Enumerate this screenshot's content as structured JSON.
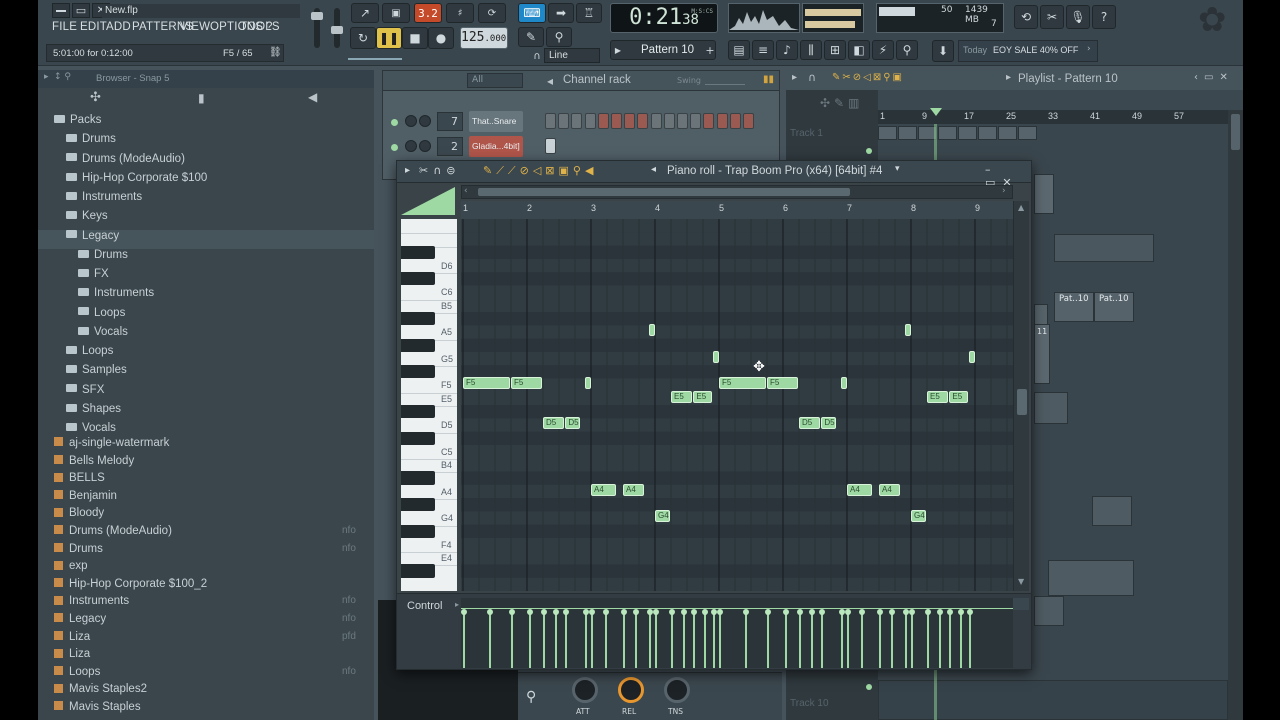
{
  "topbar": {
    "title": "New.flp",
    "menu": [
      "FILE",
      "EDIT",
      "ADD",
      "PATTERNS",
      "VIEW",
      "OPTIONS",
      "TOOLS",
      "?"
    ],
    "hint_left": "5:01:00 for 0:12:00",
    "hint_right": "F5 / 65",
    "snap_value": "3.2",
    "tempo": "125",
    "tempo_decimal": ".000",
    "time": "0:21",
    "time_small": "38",
    "time_format": "M:S:CS",
    "pattern": "Pattern 10",
    "line": "Line",
    "cpu": "50",
    "memory": "1439 MB",
    "voices": "7",
    "news_day": "Today",
    "news_text": "EOY SALE 40% OFF"
  },
  "browser": {
    "title": "Browser - Snap 5",
    "tree": [
      {
        "label": "Packs",
        "indent": 0
      },
      {
        "label": "Drums",
        "indent": 1
      },
      {
        "label": "Drums (ModeAudio)",
        "indent": 1
      },
      {
        "label": "Hip-Hop Corporate $100",
        "indent": 1
      },
      {
        "label": "Instruments",
        "indent": 1
      },
      {
        "label": "Keys",
        "indent": 1
      },
      {
        "label": "Legacy",
        "indent": 1
      },
      {
        "label": "Drums",
        "indent": 2
      },
      {
        "label": "FX",
        "indent": 2
      },
      {
        "label": "Instruments",
        "indent": 2
      },
      {
        "label": "Loops",
        "indent": 2
      },
      {
        "label": "Vocals",
        "indent": 2
      },
      {
        "label": "Loops",
        "indent": 1
      },
      {
        "label": "Samples",
        "indent": 1
      },
      {
        "label": "SFX",
        "indent": 1
      },
      {
        "label": "Shapes",
        "indent": 1
      },
      {
        "label": "Vocals",
        "indent": 1
      }
    ],
    "files": [
      {
        "label": "aj-single-watermark",
        "ext": ""
      },
      {
        "label": "Bells Melody",
        "ext": ""
      },
      {
        "label": "BELLS",
        "ext": ""
      },
      {
        "label": "Benjamin",
        "ext": ""
      },
      {
        "label": "Bloody",
        "ext": ""
      },
      {
        "label": "Drums (ModeAudio)",
        "ext": "nfo"
      },
      {
        "label": "Drums",
        "ext": "nfo"
      },
      {
        "label": "exp",
        "ext": ""
      },
      {
        "label": "Hip-Hop Corporate $100_2",
        "ext": ""
      },
      {
        "label": "Instruments",
        "ext": "nfo"
      },
      {
        "label": "Legacy",
        "ext": "nfo"
      },
      {
        "label": "Liza",
        "ext": "pfd"
      },
      {
        "label": "Liza",
        "ext": ""
      },
      {
        "label": "Loops",
        "ext": "nfo"
      },
      {
        "label": "Mavis Staples2",
        "ext": ""
      },
      {
        "label": "Mavis Staples",
        "ext": ""
      }
    ]
  },
  "channel_rack": {
    "filter": "All",
    "title": "Channel rack",
    "swing": "Swing",
    "channels": [
      {
        "num": "7",
        "name": "That..Snare"
      },
      {
        "num": "2",
        "name": "Gladia...4bit]"
      }
    ]
  },
  "playlist": {
    "title": "Playlist - Pattern 10",
    "bar_numbers": [
      "1",
      "9",
      "17",
      "25",
      "33",
      "41",
      "49",
      "57"
    ],
    "track_first": "Track 1",
    "track_last": "Track 10",
    "clip_label": "Pat..10",
    "clip_label_b": "11"
  },
  "pianoroll": {
    "title": "Piano roll - Trap Boom Pro (x64) [64bit] #4",
    "control_label": "Control",
    "bars": [
      "1",
      "2",
      "3",
      "4",
      "5",
      "6",
      "7",
      "8",
      "9"
    ],
    "keys": [
      "D6",
      "C6",
      "B5",
      "A5",
      "G5",
      "F5",
      "E5",
      "D5",
      "C5",
      "B4",
      "A4",
      "G4",
      "F4",
      "E4"
    ],
    "notes": [
      {
        "name": "F5",
        "bar": 1.0,
        "len": 0.75
      },
      {
        "name": "F5",
        "bar": 1.75,
        "len": 0.5
      },
      {
        "name": "D5",
        "bar": 2.25,
        "len": 0.35
      },
      {
        "name": "D5",
        "bar": 2.6,
        "len": 0.25
      },
      {
        "name": "F5",
        "bar": 2.9,
        "len": 0.12
      },
      {
        "name": "A4",
        "bar": 3.0,
        "len": 0.4
      },
      {
        "name": "A4",
        "bar": 3.5,
        "len": 0.35
      },
      {
        "name": "A5",
        "bar": 3.9,
        "len": 0.12
      },
      {
        "name": "G4",
        "bar": 4.0,
        "len": 0.25
      },
      {
        "name": "E5",
        "bar": 4.25,
        "len": 0.35
      },
      {
        "name": "E5",
        "bar": 4.6,
        "len": 0.3
      },
      {
        "name": "G5",
        "bar": 4.9,
        "len": 0.12
      },
      {
        "name": "F5",
        "bar": 5.0,
        "len": 0.75
      },
      {
        "name": "F5",
        "bar": 5.75,
        "len": 0.5
      },
      {
        "name": "D5",
        "bar": 6.25,
        "len": 0.35
      },
      {
        "name": "D5",
        "bar": 6.6,
        "len": 0.25
      },
      {
        "name": "F5",
        "bar": 6.9,
        "len": 0.12
      },
      {
        "name": "A4",
        "bar": 7.0,
        "len": 0.4
      },
      {
        "name": "A4",
        "bar": 7.5,
        "len": 0.35
      },
      {
        "name": "A5",
        "bar": 7.9,
        "len": 0.12
      },
      {
        "name": "G4",
        "bar": 8.0,
        "len": 0.25
      },
      {
        "name": "E5",
        "bar": 8.25,
        "len": 0.35
      },
      {
        "name": "E5",
        "bar": 8.6,
        "len": 0.3
      },
      {
        "name": "G5",
        "bar": 8.9,
        "len": 0.12
      }
    ]
  },
  "mixer": {
    "knobs": [
      "ATT",
      "REL",
      "TNS"
    ]
  }
}
